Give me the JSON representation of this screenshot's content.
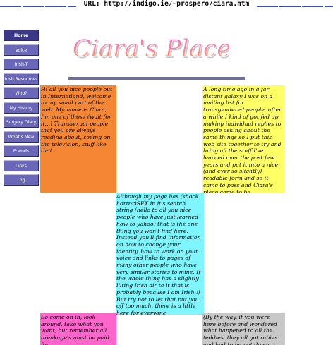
{
  "browser": {
    "url_label": "URL: http://indigo.ie/~prospero/ciara.htm"
  },
  "site": {
    "logo_text": "Ciara's Place"
  },
  "nav": {
    "items": [
      {
        "label": "Home",
        "active": true
      },
      {
        "label": "Voice"
      },
      {
        "label": "Irish-T"
      },
      {
        "label": "Irish Resources"
      },
      {
        "label": "Who?"
      },
      {
        "label": "My History"
      },
      {
        "label": "Surgery Diary"
      },
      {
        "label": "What's New"
      },
      {
        "label": "Friends"
      },
      {
        "label": "Links"
      },
      {
        "label": "Log"
      }
    ]
  },
  "content": {
    "intro": "Hi all you nice people out in Internetland, welcome to my small part of the web. My name is Ciara, I'm one of those (wait for it...) Transsexual people that you are always reading about, seeing on the television, stuff like that.",
    "history": "A long time ago in a far distant galaxy I was on a mailing list for transgendered people, after a while I kind of got fed up making individual replies to people asking about the same things so I put this web site together to try and bring all the stuff I've learned over the past few years and put it into a nice (and ever so slightly) readable form and so it came to pass and Ciara's place came to be.",
    "search": "Although my page has (shock horror)SEX in it's search string (hello to all you nice people who have just learned how to yahoo) that is the one thing you won't find here. Instead you'll find information on how to change your identity, how to work on your voice and links to pages of many other people who have very similar stories to mine. If the whole thing has a slightly lilting Irish air to it that is probably because I am Irish :) But try not to let that put you off too much, there is a little here for everyone",
    "welcome": "So come on in, look around, take what you want, but remember all breakage's must be paid for.",
    "teddies": "(By the way, if you were here before and wondered what happened to all the teddies, they all got rabies and had to be put down :)"
  },
  "colors": {
    "orange": "#f58634",
    "yellow": "#ffff66",
    "cyan": "#7ff6ff",
    "pink": "#fe66cc",
    "grey": "#c8c8c8",
    "nav": "#6a67b8",
    "logo_pink": "#f06dc6",
    "logo_orange": "#ff9a2a"
  }
}
